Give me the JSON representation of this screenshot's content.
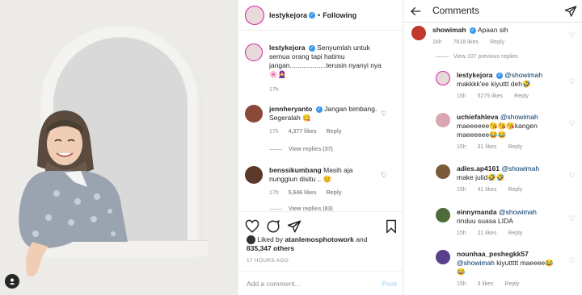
{
  "post": {
    "username": "lestykejora",
    "follow_label": "Following",
    "caption": "Senyumlah untuk semua orang tapi hatimu jangan...................terusin nyanyi nya 🌸🧕",
    "caption_time": "17h",
    "comments": [
      {
        "user": "jennheryanto",
        "text": "Jangan bimbang. Segeralah 😋",
        "time": "17h",
        "likes": "4,377 likes",
        "reply": "Reply",
        "view_replies": "View replies (37)"
      },
      {
        "user": "benssikumbang",
        "text": "Masih aja nunggiun disitu .. 😊",
        "time": "17h",
        "likes": "5,646 likes",
        "reply": "Reply",
        "view_replies": "View replies (83)"
      }
    ],
    "liked_by_prefix": "Liked by",
    "liked_by_user": "atanlemosphotowork",
    "liked_by_and": "and",
    "liked_by_others": "835,347 others",
    "time_ago": "17 HOURS AGO",
    "add_comment_placeholder": "Add a comment...",
    "post_button": "Post"
  },
  "mobile": {
    "title": "Comments",
    "top": {
      "user": "showimah",
      "text": "Apaan sih",
      "time": "16h",
      "likes": "7618 likes",
      "reply": "Reply"
    },
    "view_previous": "View 107 previous replies",
    "replies": [
      {
        "user": "lestykejora",
        "mention": "@showimah",
        "text": "makkkk'ee kiyuttt deh🤣",
        "time": "15h",
        "likes": "5275 likes",
        "reply": "Reply"
      },
      {
        "user": "uchiefahleva",
        "mention": "@showimah",
        "text": "maeeeeee😘😘😘kangen maeeeeee😂😂",
        "time": "15h",
        "likes": "31 likes",
        "reply": "Reply"
      },
      {
        "user": "adies.ap4161",
        "mention": "@showimah",
        "text": "make julid🤣🤣",
        "time": "15h",
        "likes": "41 likes",
        "reply": "Reply"
      },
      {
        "user": "einnymanda",
        "mention": "@showimah",
        "text": "rinduu suasa LIDA",
        "time": "15h",
        "likes": "21 likes",
        "reply": "Reply"
      },
      {
        "user": "nounhaa_peshegkk57",
        "mention": "@showimah",
        "text": "kiyuttttt maeeee😂😂",
        "time": "15h",
        "likes": "3 likes",
        "reply": "Reply"
      }
    ]
  },
  "colors": {
    "link": "#003569",
    "verified": "#3897f0",
    "muted": "#8e8e8e",
    "post_btn": "#b2dffc"
  }
}
